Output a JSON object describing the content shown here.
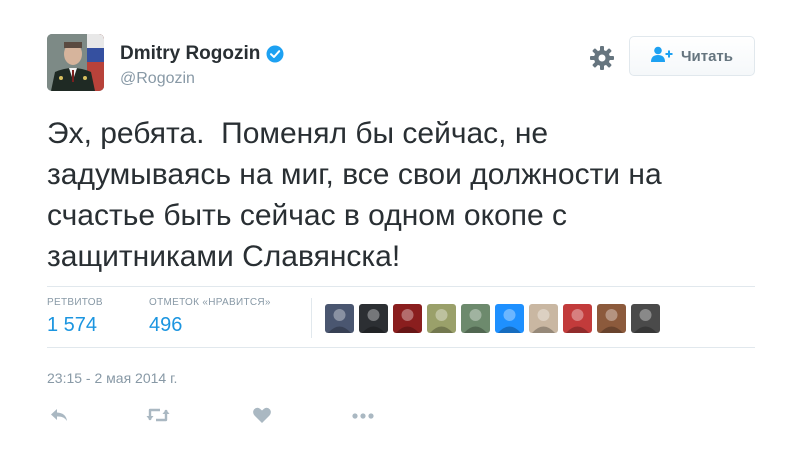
{
  "user": {
    "name": "Dmitry Rogozin",
    "handle": "@Rogozin",
    "verified": true
  },
  "header": {
    "settings_icon": "gear-icon",
    "follow_label": "Читать",
    "follow_icon": "add-user-icon"
  },
  "tweet": {
    "text": "Эх, ребята.  Поменял бы сейчас, не\nзадумываясь на миг, все свои должности на\nсчастье быть сейчас в одном окопе с\nзащитниками Славянска!",
    "timestamp": "23:15 - 2 мая 2014 г."
  },
  "stats": {
    "retweets_label": "РЕТВИТОВ",
    "retweets_value": "1 574",
    "likes_label": "ОТМЕТОК «НРАВИТСЯ»",
    "likes_value": "496"
  },
  "likers": [
    {
      "icon": "liker-avatar-1",
      "color": "#4a5670"
    },
    {
      "icon": "liker-avatar-2",
      "color": "#2c2f33"
    },
    {
      "icon": "liker-avatar-3",
      "color": "#8a1e1e"
    },
    {
      "icon": "liker-avatar-4",
      "color": "#9aa06a"
    },
    {
      "icon": "liker-avatar-5",
      "color": "#6d8a6d"
    },
    {
      "icon": "liker-avatar-6",
      "color": "#1e90ff"
    },
    {
      "icon": "liker-avatar-7",
      "color": "#c9b7a2"
    },
    {
      "icon": "liker-avatar-8",
      "color": "#c23b3b"
    },
    {
      "icon": "liker-avatar-9",
      "color": "#8c5a3c"
    },
    {
      "icon": "liker-avatar-10",
      "color": "#4a4a4a"
    }
  ],
  "actions": [
    "reply-icon",
    "retweet-icon",
    "heart-icon",
    "more-icon"
  ],
  "colors": {
    "accent": "#1da1f2",
    "link": "#1b95e0",
    "muted": "#8899a6",
    "icon": "#aab8c2"
  }
}
